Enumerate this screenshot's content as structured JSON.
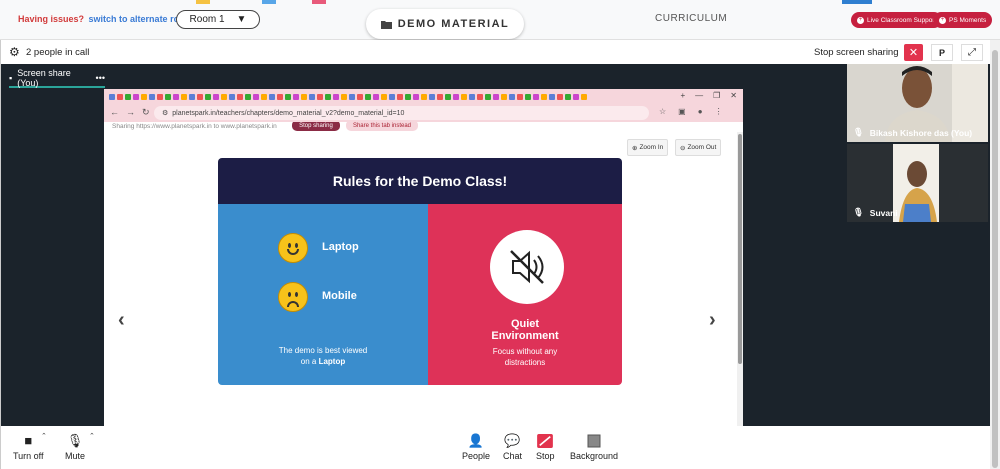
{
  "topbar": {
    "issue_label": "Having issues?",
    "switch_label": "switch to alternate room",
    "room_label": "Room 1",
    "demo_material_label": "DEMO MATERIAL",
    "curriculum_label": "CURRICULUM",
    "live_support_label": "Live Classroom Support",
    "ps_moments_label": "PS Moments"
  },
  "call": {
    "people_count_label": "2 people in call",
    "stop_sharing_label": "Stop screen sharing",
    "p_button_label": "P",
    "share_tab_label": "Screen share (You)"
  },
  "browser": {
    "url": "planetspark.in/teachers/chapters/demo_material_v2?demo_material_id=10",
    "sharing_text": "Sharing https://www.planetspark.in to www.planetspark.in",
    "stop_sharing_label": "Stop sharing",
    "share_tab_instead_label": "Share this tab instead",
    "zoom_in_label": "Zoom In",
    "zoom_out_label": "Zoom Out"
  },
  "slide": {
    "title": "Rules for the Demo Class!",
    "laptop_label": "Laptop",
    "mobile_label": "Mobile",
    "best_viewed_prefix": "The demo is best viewed",
    "on_a": "on a",
    "laptop_bold": "Laptop",
    "quiet_title_line1": "Quiet",
    "quiet_title_line2": "Environment",
    "quiet_sub_line1": "Focus without any",
    "quiet_sub_line2": "distractions"
  },
  "participants": [
    {
      "name": "Bikash Kishore das (You)"
    },
    {
      "name": "Suvani"
    }
  ],
  "controls": {
    "camera_label": "Turn off",
    "mic_label": "Mute",
    "people_label": "People",
    "chat_label": "Chat",
    "stop_label": "Stop",
    "background_label": "Background"
  },
  "colors": {
    "accent_red": "#de3258",
    "slide_blue": "#3a8dcd",
    "slide_navy": "#1c1d45",
    "share_teal": "#2ba59a"
  }
}
